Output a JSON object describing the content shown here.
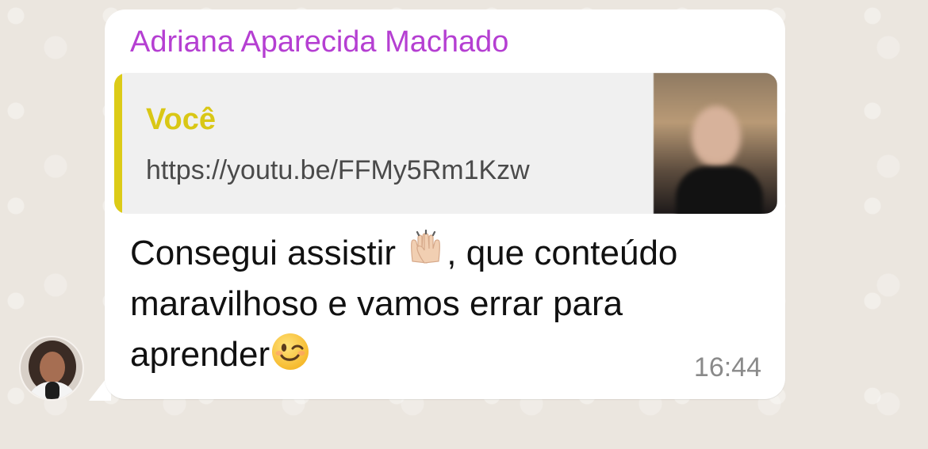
{
  "chat": {
    "sender_name": "Adriana Aparecida Machado",
    "reply": {
      "author": "Você",
      "link": "https://youtu.be/FFMy5Rm1Kzw"
    },
    "message": {
      "part1": "Consegui assistir ",
      "emoji1": "raising-hands-emoji",
      "part2": ", que conteúdo maravilhoso e vamos errar para aprender",
      "emoji2": "winking-face-emoji"
    },
    "time": "16:44"
  },
  "colors": {
    "sender": "#b53fd2",
    "quote_bar": "#dccb17",
    "quote_author": "#d9c715",
    "bubble": "#ffffff",
    "background": "#ece5dd"
  }
}
